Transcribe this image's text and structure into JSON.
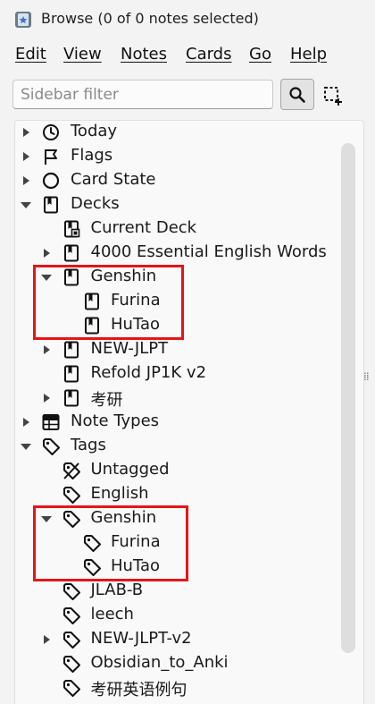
{
  "window": {
    "title": "Browse (0 of 0 notes selected)",
    "icon": "anki-star-icon"
  },
  "menu": {
    "items": [
      {
        "label": "Edit"
      },
      {
        "label": "View"
      },
      {
        "label": "Notes"
      },
      {
        "label": "Cards"
      },
      {
        "label": "Go"
      },
      {
        "label": "Help"
      }
    ]
  },
  "search": {
    "placeholder": "Sidebar filter",
    "value": ""
  },
  "sidebar": {
    "rows": [
      {
        "label": "Today",
        "icon": "clock-icon",
        "expanded": false,
        "has_arrow": true
      },
      {
        "label": "Flags",
        "icon": "flag-icon",
        "expanded": false,
        "has_arrow": true
      },
      {
        "label": "Card State",
        "icon": "circle-icon",
        "expanded": false,
        "has_arrow": true
      },
      {
        "label": "Decks",
        "icon": "deck-icon",
        "expanded": true,
        "has_arrow": true
      },
      {
        "label": "Current Deck",
        "icon": "current-deck-icon",
        "has_arrow": false
      },
      {
        "label": "4000 Essential English Words",
        "icon": "deck-icon",
        "expanded": false,
        "has_arrow": true
      },
      {
        "label": "Genshin",
        "icon": "deck-icon",
        "expanded": true,
        "has_arrow": true
      },
      {
        "label": "Furina",
        "icon": "deck-icon",
        "has_arrow": false
      },
      {
        "label": "HuTao",
        "icon": "deck-icon",
        "has_arrow": false
      },
      {
        "label": "NEW-JLPT",
        "icon": "deck-icon",
        "expanded": false,
        "has_arrow": true
      },
      {
        "label": "Refold JP1K v2",
        "icon": "deck-icon",
        "has_arrow": false
      },
      {
        "label": "考研",
        "icon": "deck-icon",
        "expanded": false,
        "has_arrow": true
      },
      {
        "label": "Note Types",
        "icon": "note-types-icon",
        "expanded": false,
        "has_arrow": true
      },
      {
        "label": "Tags",
        "icon": "tag-icon",
        "expanded": true,
        "has_arrow": true
      },
      {
        "label": "Untagged",
        "icon": "untagged-icon",
        "has_arrow": false
      },
      {
        "label": "English",
        "icon": "tag-icon",
        "has_arrow": false
      },
      {
        "label": "Genshin",
        "icon": "tag-icon",
        "expanded": true,
        "has_arrow": true
      },
      {
        "label": "Furina",
        "icon": "tag-icon",
        "has_arrow": false
      },
      {
        "label": "HuTao",
        "icon": "tag-icon",
        "has_arrow": false
      },
      {
        "label": "JLAB-B",
        "icon": "tag-icon",
        "has_arrow": false
      },
      {
        "label": "leech",
        "icon": "tag-icon",
        "has_arrow": false
      },
      {
        "label": "NEW-JLPT-v2",
        "icon": "tag-icon",
        "expanded": false,
        "has_arrow": true
      },
      {
        "label": "Obsidian_to_Anki",
        "icon": "tag-icon",
        "has_arrow": false
      },
      {
        "label": "考研英语例句",
        "icon": "tag-icon",
        "has_arrow": false
      }
    ]
  },
  "colors": {
    "highlight": "#e3161a",
    "background": "#f3f3f3"
  }
}
